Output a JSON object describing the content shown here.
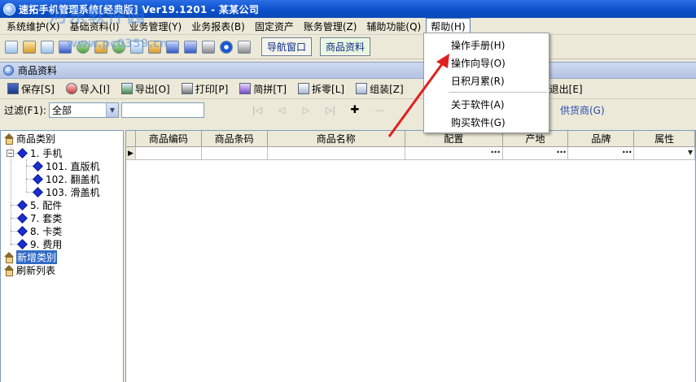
{
  "window": {
    "title": "速拓手机管理系统[经典版] Ver19.1201 - 某某公司"
  },
  "menubar": {
    "items": [
      "系统维护(X)",
      "基础资料(I)",
      "业务管理(Y)",
      "业务报表(B)",
      "固定资产",
      "账务管理(Z)",
      "辅助功能(Q)",
      "帮助(H)"
    ]
  },
  "toolbar": {
    "nav_window_label": "导航窗口",
    "product_data_label": "商品资料"
  },
  "child_window": {
    "title": "商品资料"
  },
  "actions": {
    "save": "保存[S]",
    "import": "导入[I]",
    "export": "导出[O]",
    "print": "打印[P]",
    "simple_join": "简拼[T]",
    "split": "拆零[L]",
    "assemble": "组装[Z]",
    "exit": "退出[E]"
  },
  "filter": {
    "label": "过滤(F1):",
    "selected": "全部",
    "supplier_label": "供货商(G)"
  },
  "tree": {
    "root": "商品类别",
    "nodes": [
      {
        "label": "1. 手机"
      },
      {
        "label": "101. 直版机"
      },
      {
        "label": "102. 翻盖机"
      },
      {
        "label": "103. 滑盖机"
      },
      {
        "label": "5. 配件"
      },
      {
        "label": "7. 套类"
      },
      {
        "label": "8. 卡类"
      },
      {
        "label": "9. 费用"
      }
    ],
    "add_category": "新增类别",
    "refresh_list": "刷新列表"
  },
  "grid": {
    "columns": [
      "商品编码",
      "商品条码",
      "商品名称",
      "配置",
      "产地",
      "品牌",
      "属性"
    ]
  },
  "help_menu": {
    "items": [
      "操作手册(H)",
      "操作向导(O)",
      "日积月累(R)",
      "关于软件(A)",
      "购买软件(G)"
    ]
  },
  "watermark": {
    "text": "河东软件园",
    "url": "www.pc0359.cn"
  },
  "colors": {
    "titlebar": "#0a4ec8",
    "tree_diamond": "#1a2ed0",
    "selection": "#316ac5",
    "arrow": "#e02020"
  }
}
